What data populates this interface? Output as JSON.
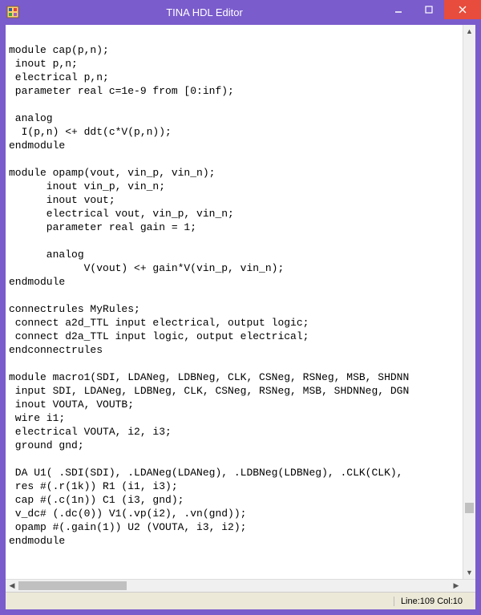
{
  "window": {
    "title": "TINA HDL Editor"
  },
  "editor": {
    "content": "\nmodule cap(p,n);\n inout p,n;\n electrical p,n;\n parameter real c=1e-9 from [0:inf);\n\n analog\n  I(p,n) <+ ddt(c*V(p,n));\nendmodule\n\nmodule opamp(vout, vin_p, vin_n);\n      inout vin_p, vin_n;\n      inout vout;\n      electrical vout, vin_p, vin_n;\n      parameter real gain = 1;\n\n      analog\n            V(vout) <+ gain*V(vin_p, vin_n);\nendmodule\n\nconnectrules MyRules;\n connect a2d_TTL input electrical, output logic;\n connect d2a_TTL input logic, output electrical;\nendconnectrules\n\nmodule macro1(SDI, LDANeg, LDBNeg, CLK, CSNeg, RSNeg, MSB, SHDNN\n input SDI, LDANeg, LDBNeg, CLK, CSNeg, RSNeg, MSB, SHDNNeg, DGN\n inout VOUTA, VOUTB;\n wire i1;\n electrical VOUTA, i2, i3;\n ground gnd;\n\n DA U1( .SDI(SDI), .LDANeg(LDANeg), .LDBNeg(LDBNeg), .CLK(CLK),\n res #(.r(1k)) R1 (i1, i3);\n cap #(.c(1n)) C1 (i3, gnd);\n v_dc# (.dc(0)) V1(.vp(i2), .vn(gnd));\n opamp #(.gain(1)) U2 (VOUTA, i3, i2);\nendmodule"
  },
  "status": {
    "line_col": "Line:109 Col:10"
  },
  "scroll": {
    "v_thumb_top_pct": 88,
    "v_thumb_height_pct": 2,
    "h_thumb_left_pct": 0,
    "h_thumb_width_pct": 25
  }
}
